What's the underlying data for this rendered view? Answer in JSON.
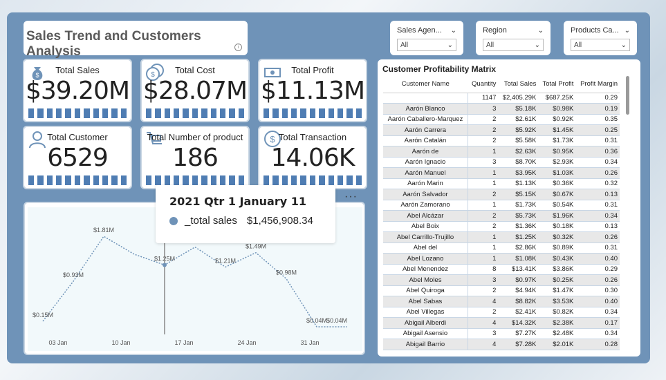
{
  "title": "Sales Trend and Customers Analysis",
  "slicers": [
    {
      "label": "Sales Agen...",
      "value": "All"
    },
    {
      "label": "Region",
      "value": "All"
    },
    {
      "label": "Products Ca...",
      "value": "All"
    }
  ],
  "kpis": {
    "total_sales": {
      "title": "Total Sales",
      "value": "$39.20M",
      "icon": "money-bag-icon"
    },
    "total_cost": {
      "title": "Total Cost",
      "value": "$28.07M",
      "icon": "coins-icon"
    },
    "total_profit": {
      "title": "Total Profit",
      "value": "$11.13M",
      "icon": "cash-icon"
    },
    "total_customer": {
      "title": "Total Customer",
      "value": "6529",
      "icon": "user-icon"
    },
    "total_products": {
      "title": "Total Number of product",
      "value": "186",
      "icon": "cart-icon"
    },
    "total_transaction": {
      "title": "Total Transaction",
      "value": "14.06K",
      "icon": "dollar-icon"
    }
  },
  "tooltip": {
    "title": "2021 Qtr 1 January 11",
    "series": "_total sales",
    "value": "$1,456,908.34"
  },
  "chart_data": {
    "type": "line",
    "x_ticks": [
      "03 Jan",
      "10 Jan",
      "17 Jan",
      "24 Jan",
      "31 Jan"
    ],
    "points": [
      {
        "x": 0,
        "y": 0.15,
        "label": "$0.15M"
      },
      {
        "x": 1,
        "y": 0.93,
        "label": "$0.93M"
      },
      {
        "x": 2,
        "y": 1.81,
        "label": "$1.81M"
      },
      {
        "x": 3,
        "y": 1.46,
        "label": ""
      },
      {
        "x": 4,
        "y": 1.25,
        "label": "$1.25M"
      },
      {
        "x": 5,
        "y": 1.6,
        "label": ""
      },
      {
        "x": 6,
        "y": 1.21,
        "label": "$1.21M"
      },
      {
        "x": 7,
        "y": 1.49,
        "label": "$1.49M"
      },
      {
        "x": 8,
        "y": 0.98,
        "label": "$0.98M"
      },
      {
        "x": 9,
        "y": 0.04,
        "label": "$0.04M"
      },
      {
        "x": 10,
        "y": 0.04,
        "label": "$0.04M"
      }
    ],
    "ylim": [
      0,
      2
    ]
  },
  "matrix": {
    "title": "Customer Profitability Matrix",
    "columns": [
      "Customer Name",
      "Quantity",
      "Total Sales",
      "Total Profit",
      "Profit Margin"
    ],
    "total": [
      "",
      "1147",
      "$2,405.29K",
      "$687.25K",
      "0.29"
    ],
    "rows": [
      [
        "Aarón Blanco",
        "3",
        "$5.18K",
        "$0.98K",
        "0.19"
      ],
      [
        "Aarón Caballero-Marquez",
        "2",
        "$2.61K",
        "$0.92K",
        "0.35"
      ],
      [
        "Aarón Carrera",
        "2",
        "$5.92K",
        "$1.45K",
        "0.25"
      ],
      [
        "Aarón Catalán",
        "2",
        "$5.58K",
        "$1.73K",
        "0.31"
      ],
      [
        "Aarón de",
        "1",
        "$2.63K",
        "$0.95K",
        "0.36"
      ],
      [
        "Aarón Ignacio",
        "3",
        "$8.70K",
        "$2.93K",
        "0.34"
      ],
      [
        "Aarón Manuel",
        "1",
        "$3.95K",
        "$1.03K",
        "0.26"
      ],
      [
        "Aarón Marin",
        "1",
        "$1.13K",
        "$0.36K",
        "0.32"
      ],
      [
        "Aarón Salvador",
        "2",
        "$5.15K",
        "$0.67K",
        "0.13"
      ],
      [
        "Aarón Zamorano",
        "1",
        "$1.73K",
        "$0.54K",
        "0.31"
      ],
      [
        "Abel Alcázar",
        "2",
        "$5.73K",
        "$1.96K",
        "0.34"
      ],
      [
        "Abel Boix",
        "2",
        "$1.36K",
        "$0.18K",
        "0.13"
      ],
      [
        "Abel Carrillo-Trujillo",
        "1",
        "$1.25K",
        "$0.32K",
        "0.26"
      ],
      [
        "Abel del",
        "1",
        "$2.86K",
        "$0.89K",
        "0.31"
      ],
      [
        "Abel Lozano",
        "1",
        "$1.08K",
        "$0.43K",
        "0.40"
      ],
      [
        "Abel Menendez",
        "8",
        "$13.41K",
        "$3.86K",
        "0.29"
      ],
      [
        "Abel Moles",
        "3",
        "$0.97K",
        "$0.25K",
        "0.26"
      ],
      [
        "Abel Quiroga",
        "2",
        "$4.94K",
        "$1.47K",
        "0.30"
      ],
      [
        "Abel Sabas",
        "4",
        "$8.82K",
        "$3.53K",
        "0.40"
      ],
      [
        "Abel Villegas",
        "2",
        "$2.41K",
        "$0.82K",
        "0.34"
      ],
      [
        "Abigail Alberdi",
        "4",
        "$14.32K",
        "$2.38K",
        "0.17"
      ],
      [
        "Abigail Asensio",
        "3",
        "$7.27K",
        "$2.48K",
        "0.34"
      ],
      [
        "Abigail Barrio",
        "4",
        "$7.28K",
        "$2.01K",
        "0.28"
      ]
    ]
  },
  "colors": {
    "accent": "#4f7db3",
    "panel": "#6f93b8",
    "line": "#6f93b8"
  }
}
